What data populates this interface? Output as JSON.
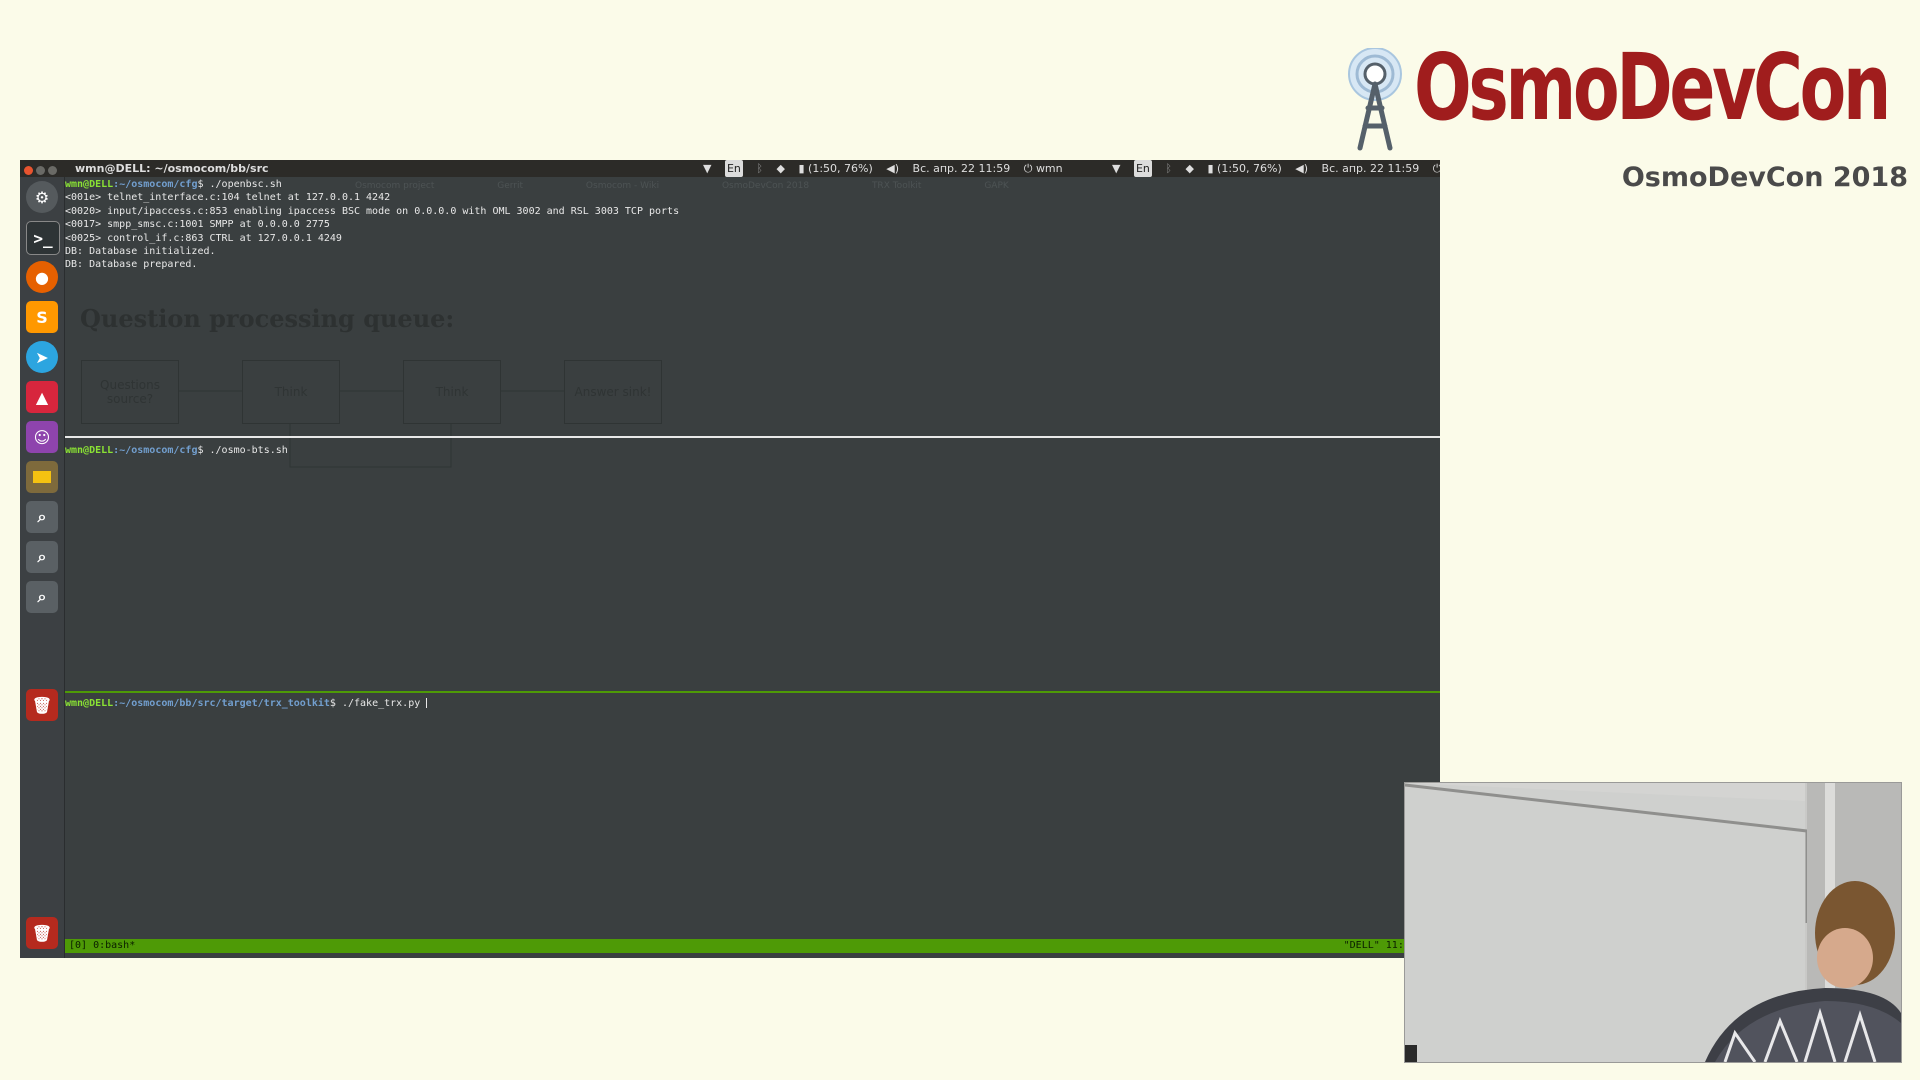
{
  "brand": {
    "title": "OsmoDevCon",
    "subtitle": "OsmoDevCon 2018"
  },
  "topbar": {
    "window_title": "wmn@DELL: ~/osmocom/bb/src",
    "indicators": [
      {
        "icon": "wifi-icon"
      },
      {
        "text": "En"
      },
      {
        "icon": "bluetooth-icon"
      },
      {
        "icon": "bell-icon"
      },
      {
        "text": "(1:50, 76%)"
      },
      {
        "icon": "volume-icon"
      },
      {
        "text": "Вс. апр. 22 11:59"
      },
      {
        "text": "wmn"
      }
    ]
  },
  "launcher": {
    "items": [
      {
        "icon": "ubuntu-dash-icon",
        "color": "#555a5d"
      },
      {
        "icon": "terminal-icon",
        "color": "#2e3436"
      },
      {
        "icon": "firefox-icon",
        "color": "#e66000"
      },
      {
        "icon": "sublime-text-icon",
        "color": "#ff9800",
        "glyph": "S"
      },
      {
        "icon": "telegram-icon",
        "color": "#2ca5e0"
      },
      {
        "icon": "upload-icon",
        "color": "#d7263d"
      },
      {
        "icon": "pidgin-icon",
        "color": "#8e44ad"
      },
      {
        "icon": "files-icon",
        "color": "#7e6a3c"
      },
      {
        "icon": "system-icon-1",
        "color": "#5a6064"
      },
      {
        "icon": "system-icon-2",
        "color": "#5a6064"
      },
      {
        "icon": "system-icon-3",
        "color": "#5a6064"
      },
      {
        "icon": "trash-icon",
        "color": "#b52a1e"
      },
      {
        "icon": "trash-icon",
        "color": "#b52a1e"
      }
    ]
  },
  "pane1": {
    "prompt_user": "wmn@DELL",
    "prompt_path": ":~/osmocom/cfg",
    "prompt_cmd": "$ ./openbsc.sh",
    "lines": [
      "<001e> telnet_interface.c:104 telnet at 127.0.0.1 4242",
      "<0020> input/ipaccess.c:853 enabling ipaccess BSC mode on 0.0.0.0 with OML 3002 and RSL 3003 TCP ports",
      "<0017> smpp_smsc.c:1001 SMPP at 0.0.0.0 2775",
      "<0025> control_if.c:863 CTRL at 127.0.0.1 4249",
      "DB: Database initialized.",
      "DB: Database prepared."
    ]
  },
  "ghost": {
    "tabs": [
      "Osmocom project",
      "Gerrit",
      "Osmocom - Wiki",
      "OsmoDevCon 2018",
      "TRX Toolkit",
      "GAPK"
    ],
    "heading": "Question processing queue:",
    "boxes": [
      "Questions source?",
      "Think",
      "Think",
      "Answer sink!"
    ]
  },
  "pane2": {
    "prompt_user": "wmn@DELL",
    "prompt_path": ":~/osmocom/cfg",
    "prompt_cmd": "$ ./osmo-bts.sh"
  },
  "pane3": {
    "prompt_user": "wmn@DELL",
    "prompt_path": ":~/osmocom/bb/src/target/trx_toolkit",
    "prompt_cmd": "$ ./fake_trx.py "
  },
  "statusbar": {
    "left": "[0] 0:bash*",
    "right": "\"DELL\" 11:59 22-A"
  }
}
